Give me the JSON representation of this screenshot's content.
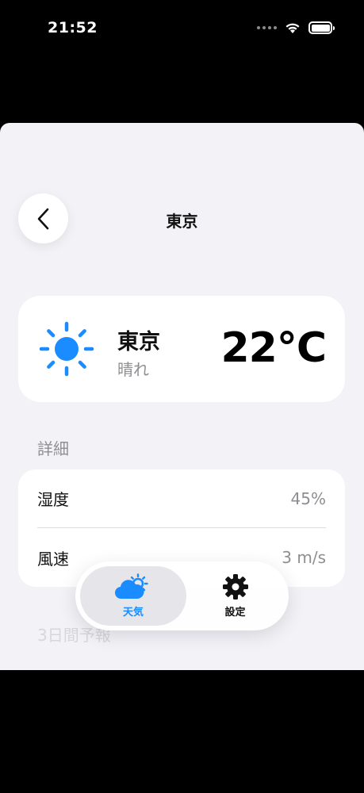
{
  "status": {
    "time": "21:52"
  },
  "nav": {
    "title": "東京"
  },
  "weather": {
    "city": "東京",
    "condition": "晴れ",
    "temperature": "22°C",
    "icon": "sun-icon"
  },
  "details": {
    "header": "詳細",
    "rows": [
      {
        "label": "湿度",
        "value": "45%"
      },
      {
        "label": "風速",
        "value": "3 m/s"
      }
    ]
  },
  "forecast": {
    "header": "3日間予報"
  },
  "tabs": [
    {
      "label": "天気",
      "icon": "cloud-sun-icon",
      "selected": true
    },
    {
      "label": "設定",
      "icon": "gear-icon",
      "selected": false
    }
  ],
  "colors": {
    "accent": "#1a8cff",
    "sheet_bg": "#f2f2f7",
    "secondary_text": "#8e8e93"
  }
}
